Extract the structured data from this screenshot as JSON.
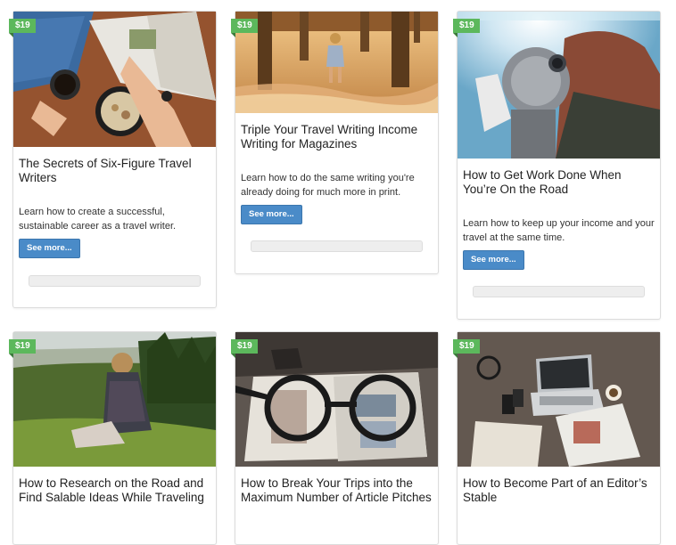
{
  "cards": [
    {
      "price": "$19",
      "title": "The Secrets of Six-Figure Travel Writers",
      "description": "Learn how to create a successful, sustainable career as a travel writer.",
      "button": "See more...",
      "image": "desk-coffee-notebook-photo"
    },
    {
      "price": "$19",
      "title": "Triple Your Travel Writing Income Writing for Magazines",
      "description": "Learn how to do the same writing you're already doing for much more in print.",
      "button": "See more...",
      "image": "girl-pier-ocean-photo"
    },
    {
      "price": "$19",
      "title": "How to Get Work Done When You’re On the Road",
      "description": "Learn how to keep up your income and your travel at the same time.",
      "button": "See more...",
      "image": "woman-binocular-viewer-photo"
    },
    {
      "price": "$19",
      "title": "How to Research on the Road and Find Salable Ideas While Traveling",
      "image": "hiker-on-hill-photo"
    },
    {
      "price": "$19",
      "title": "How to Break Your Trips into the Maximum Number of Article Pitches",
      "image": "glasses-on-magazines-photo"
    },
    {
      "price": "$19",
      "title": "How to Become Part of an Editor’s Stable",
      "image": "laptop-travel-gear-photo"
    }
  ]
}
